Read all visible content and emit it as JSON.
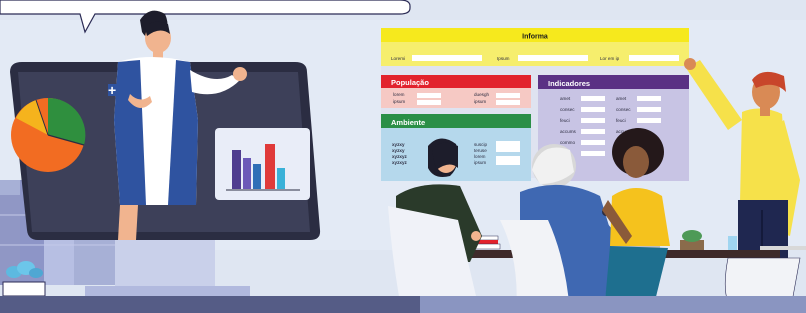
{
  "dashboard": {
    "title": "Informa",
    "top_labels": [
      "Loremi",
      "Ipsum",
      "Lor em ip"
    ],
    "populacao": {
      "heading": "População",
      "left_labels": [
        "lorem",
        "ipsum"
      ],
      "right_labels": [
        "duesgh",
        "ipsum"
      ]
    },
    "ambiente": {
      "heading": "Ambiente",
      "left_labels": [
        "xyzxy",
        "xyzxy",
        "xyzxyz",
        "xyzxyz"
      ],
      "right_labels": [
        "suscip",
        "teruse",
        "lorem",
        "ipsum"
      ]
    },
    "indicadores": {
      "heading": "Indicadores",
      "col1_labels": [
        "amet",
        "consec",
        "feuci",
        "accums",
        "commo"
      ],
      "col2_labels": [
        "amet",
        "consec",
        "feuci",
        "accum"
      ]
    }
  },
  "colors": {
    "title_bar": "#f6e91d",
    "populacao": "#e2222c",
    "ambiente": "#2a8f47",
    "indicadores": "#5a3184",
    "panel_bg": "#b5d8ec",
    "indicadores_bg": "#c8c4e4"
  },
  "monitor_pie": {
    "slices": [
      {
        "label": "green",
        "color": "#2f8f3e"
      },
      {
        "label": "orange",
        "color": "#f26c22"
      },
      {
        "label": "yellow",
        "color": "#f5b31d"
      }
    ]
  },
  "monitor_bars": {
    "bars": [
      {
        "color": "#4f3c8f"
      },
      {
        "color": "#6c59b8"
      },
      {
        "color": "#2f6fb7"
      },
      {
        "color": "#e03a3a"
      },
      {
        "color": "#3ab1d8"
      }
    ]
  }
}
